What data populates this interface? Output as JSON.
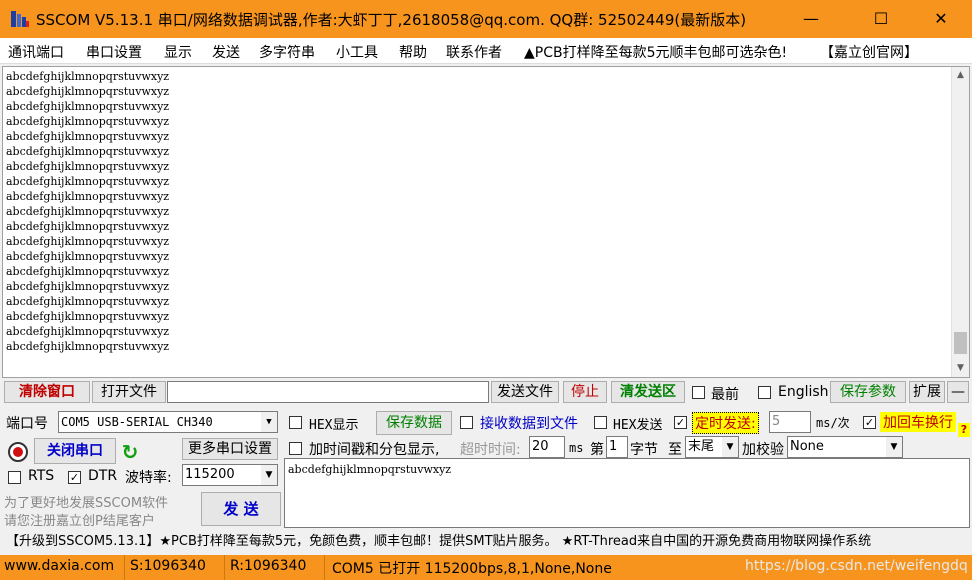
{
  "window": {
    "title": "SSCOM V5.13.1 串口/网络数据调试器,作者:大虾丁丁,2618058@qq.com. QQ群:  52502449(最新版本)",
    "minimize": "—",
    "maximize": "☐",
    "close": "✕"
  },
  "menu": [
    "通讯端口",
    "串口设置",
    "显示",
    "发送",
    "多字符串",
    "小工具",
    "帮助",
    "联系作者",
    "▲PCB打样降至每款5元顺丰包邮可选杂色!",
    "【嘉立创官网】"
  ],
  "receive": {
    "lines": [
      "abcdefghijklmnopqrstuvwxyz",
      "abcdefghijklmnopqrstuvwxyz",
      "abcdefghijklmnopqrstuvwxyz",
      "abcdefghijklmnopqrstuvwxyz",
      "abcdefghijklmnopqrstuvwxyz",
      "abcdefghijklmnopqrstuvwxyz",
      "abcdefghijklmnopqrstuvwxyz",
      "abcdefghijklmnopqrstuvwxyz",
      "abcdefghijklmnopqrstuvwxyz",
      "abcdefghijklmnopqrstuvwxyz",
      "abcdefghijklmnopqrstuvwxyz",
      "abcdefghijklmnopqrstuvwxyz",
      "abcdefghijklmnopqrstuvwxyz",
      "abcdefghijklmnopqrstuvwxyz",
      "abcdefghijklmnopqrstuvwxyz",
      "abcdefghijklmnopqrstuvwxyz",
      "abcdefghijklmnopqrstuvwxyz",
      "abcdefghijklmnopqrstuvwxyz",
      "abcdefghijklmnopqrstuvwxyz"
    ]
  },
  "toolbar": {
    "clear_window": "清除窗口",
    "open_file": "打开文件",
    "file_path": "",
    "send_file": "发送文件",
    "stop": "停止",
    "clear_send": "清发送区",
    "frontmost": "最前",
    "english": "English",
    "save_params": "保存参数",
    "expand": "扩展",
    "collapse": "—"
  },
  "port": {
    "port_label": "端口号",
    "port_value": "COM5 USB-SERIAL CH340",
    "close_port": "关闭串口",
    "more_settings": "更多串口设置",
    "rts": "RTS",
    "dtr": "DTR",
    "baud_label": "波特率:",
    "baud_value": "115200"
  },
  "options": {
    "hex_display": "HEX显示",
    "save_data": "保存数据",
    "recv_to_file": "接收数据到文件",
    "hex_send": "HEX发送",
    "timed_send": "定时发送:",
    "interval": "5",
    "interval_unit": "ms/次",
    "append_newline": "加回车换行",
    "add_timestamp": "加时间戳和分包显示,",
    "timeout_label": "超时时间:",
    "timeout_value": "20",
    "timeout_unit": "ms",
    "byte_prefix": "第",
    "byte_value": "1",
    "byte_label": "字节",
    "to_label": "至",
    "end_value": "末尾",
    "checksum_label": "加校验",
    "checksum_value": "None"
  },
  "send": {
    "text": "abcdefghijklmnopqrstuvwxyz",
    "button": "发 送"
  },
  "promo": {
    "line1": "为了更好地发展SSCOM软件",
    "line2": "请您注册嘉立创P结尾客户"
  },
  "ticker": "【升级到SSCOM5.13.1】★PCB打样降至每款5元，免颜色费，顺丰包邮！提供SMT贴片服务。 ★RT-Thread来自中国的开源免费商用物联网操作系统",
  "status": {
    "website": "www.daxia.com",
    "sent": "S:1096340",
    "received": "R:1096340",
    "port_state": "COM5 已打开  115200bps,8,1,None,None",
    "watermark": "https://blog.csdn.net/weifengdq"
  },
  "colors": {
    "title_bar": "#f6941e",
    "status_bar": "#f6941e",
    "highlight_yellow": "#ffff00",
    "accent_blue": "#0000c8",
    "accent_green": "#008000",
    "accent_red": "#c00000"
  }
}
